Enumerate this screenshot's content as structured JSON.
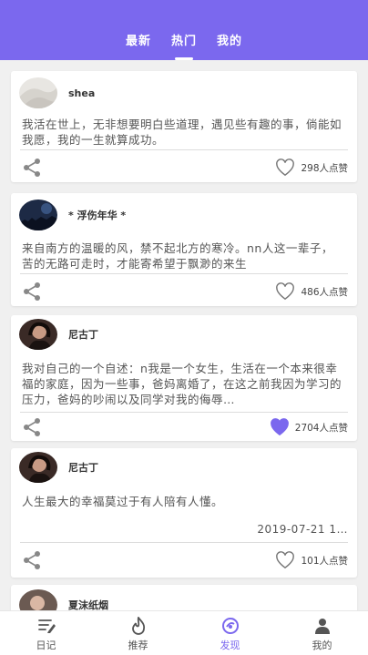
{
  "colors": {
    "accent": "#7b68ee",
    "background": "#f0f0f0"
  },
  "top_tabs": [
    {
      "label": "最新"
    },
    {
      "label": "热门",
      "active": true
    },
    {
      "label": "我的"
    }
  ],
  "posts": [
    {
      "username": "shea",
      "text": "我活在世上，无非想要明白些道理，遇见些有趣的事，倘能如我愿，我的一生就算成功。",
      "likes": "298人点赞",
      "liked": false
    },
    {
      "username": "* 浮伤年华 *",
      "text": "来自南方的温暖的风，禁不起北方的寒冷。nn人这一辈子，苦的无路可走时，才能寄希望于飘渺的来生",
      "likes": "486人点赞",
      "liked": false
    },
    {
      "username": "尼古丁",
      "text": "我对自己的一个自述：n我是一个女生，生活在一个本来很幸福的家庭，因为一些事，爸妈离婚了，在这之前我因为学习的压力，爸妈的吵闹以及同学对我的侮辱…",
      "likes": "2704人点赞",
      "liked": true
    },
    {
      "username": "尼古丁",
      "text": "人生最大的幸福莫过于有人陪有人懂。",
      "date": "2019-07-21 1…",
      "likes": "101人点赞",
      "liked": false
    },
    {
      "username": "夏沫纸烟"
    }
  ],
  "bottom_nav": [
    {
      "label": "日记",
      "icon": "diary-icon"
    },
    {
      "label": "推荐",
      "icon": "flame-icon"
    },
    {
      "label": "发现",
      "icon": "discover-icon",
      "active": true
    },
    {
      "label": "我的",
      "icon": "profile-icon"
    }
  ]
}
